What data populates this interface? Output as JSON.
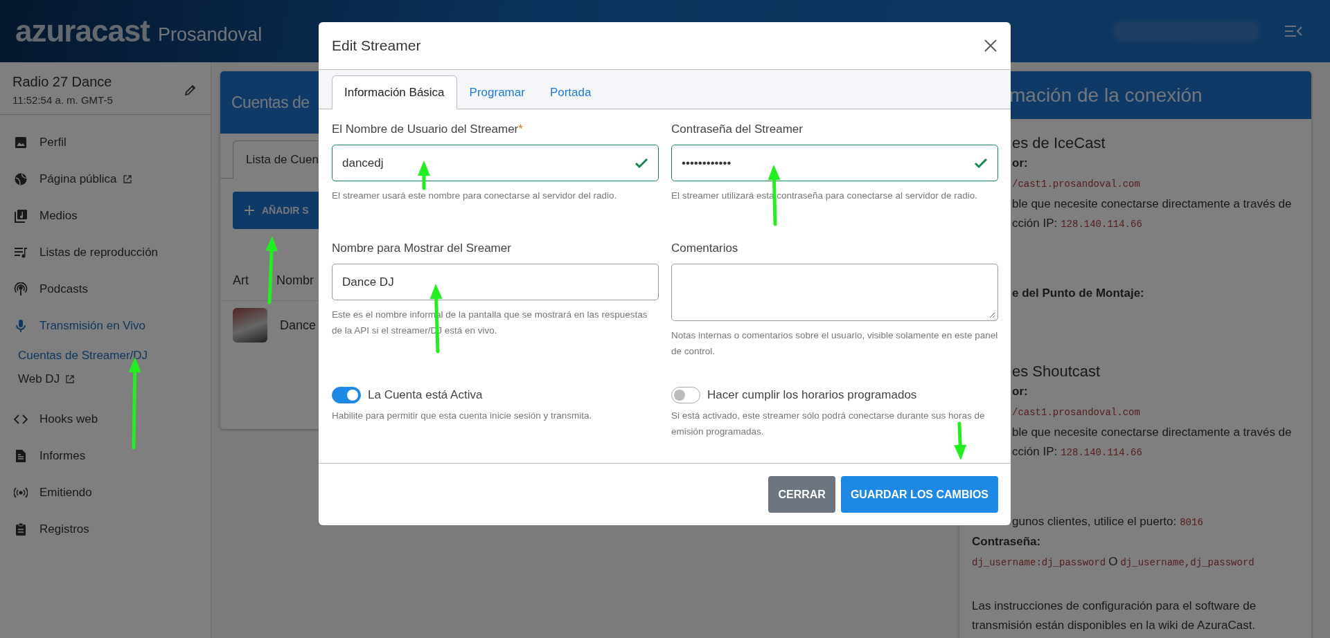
{
  "header": {
    "logo": "azura**cast**",
    "organization": "Prosandoval"
  },
  "sidebar": {
    "station": "Radio 27 Dance",
    "time": "11:52:54 a. m. GMT-5",
    "items": [
      {
        "label": "Perfil",
        "selected": false,
        "external": false
      },
      {
        "label": "Página pública",
        "selected": false,
        "external": true
      },
      {
        "label": "Medios",
        "selected": false,
        "external": false
      },
      {
        "label": "Listas de reproducción",
        "selected": false,
        "external": false
      },
      {
        "label": "Podcasts",
        "selected": false,
        "external": false
      },
      {
        "label": "Transmisión en Vivo",
        "selected": true,
        "external": false,
        "children": [
          {
            "label": "Cuentas de Streamer/DJ",
            "selected": true,
            "external": false
          },
          {
            "label": "Web DJ",
            "selected": false,
            "external": true
          }
        ]
      },
      {
        "label": "Hooks web",
        "selected": false,
        "external": false
      },
      {
        "label": "Informes",
        "selected": false,
        "external": false
      },
      {
        "label": "Emitiendo",
        "selected": false,
        "external": false
      },
      {
        "label": "Registros",
        "selected": false,
        "external": false
      }
    ]
  },
  "accounts_card": {
    "title": "Cuentas de",
    "tabs": [
      {
        "label": "Lista de Cuen",
        "selected": true
      }
    ],
    "add_button": "AÑADIR S",
    "columns": [
      "Art",
      "Nombr"
    ],
    "rows": [
      {
        "name": "Dance"
      }
    ]
  },
  "connection_card": {
    "title": "mación de la conexión",
    "sections": [
      {
        "lines": [
          {
            "kind": "heading",
            "text": "es de IceCast",
            "clipped": true
          },
          {
            "kind": "label",
            "text": "or:",
            "clipped": true
          },
          {
            "kind": "code",
            "text": "/cast1.prosandoval.com",
            "clipped": true
          },
          {
            "kind": "text",
            "text": "ble que necesite conectarse directamente a través de",
            "clipped": true
          },
          {
            "kind": "text",
            "text": "cción IP:",
            "code": "128.140.114.66",
            "clipped": true
          }
        ]
      },
      {
        "lines": [
          {
            "kind": "label",
            "text": "e del Punto de Montaje:",
            "clipped": true
          }
        ]
      },
      {
        "lines": [
          {
            "kind": "heading",
            "text": "es Shoutcast",
            "clipped": true
          },
          {
            "kind": "label",
            "text": "or:",
            "clipped": true
          },
          {
            "kind": "code",
            "text": "/cast1.prosandoval.com",
            "clipped": true
          },
          {
            "kind": "text",
            "text": "ble que necesite conectarse directamente a través de",
            "clipped": true
          },
          {
            "kind": "text",
            "text": "cción IP:",
            "code": "128.140.114.66",
            "clipped": true
          }
        ]
      },
      {
        "lines": [
          {
            "kind": "text",
            "text": "gunos clientes, utilice el puerto:",
            "code": "8016",
            "clipped": true
          },
          {
            "kind": "label",
            "text": "Contraseña:",
            "clipped": false
          },
          {
            "kind": "code",
            "text": "dj_username:dj_password",
            "after": "O",
            "code2": "dj_username,dj_password",
            "clipped": false
          }
        ]
      },
      {
        "lines": [
          {
            "kind": "text",
            "text": "Las instrucciones de configuración para el software de",
            "clipped": false
          },
          {
            "kind": "text",
            "text": "transmisión están disponibles en la wiki de AzuraCast.",
            "clipped": false
          }
        ]
      }
    ]
  },
  "modal": {
    "title": "Edit Streamer",
    "tabs": [
      {
        "label": "Información Básica",
        "selected": true
      },
      {
        "label": "Programar",
        "selected": false
      },
      {
        "label": "Portada",
        "selected": false
      }
    ],
    "fields": [
      {
        "kind": "input",
        "label": "El Nombre de Usuario del Streamer",
        "required_mark": "*",
        "value": "dancedj",
        "valid": true,
        "help": "El streamer usará este nombre para conectarse al servidor del radio."
      },
      {
        "kind": "input",
        "label": "Contraseña del Streamer",
        "value": "••••••••••••",
        "valid": true,
        "help": "El streamer utilizará esta contraseña para conectarse al servidor de radio."
      },
      {
        "kind": "input",
        "label": "Nombre para Mostrar del Sreamer",
        "value": "Dance DJ",
        "valid": false,
        "help": "Este es el nombre informal de la pantalla que se mostrará en las respuestas de la API si el streamer/DJ está en vivo."
      },
      {
        "kind": "textarea",
        "label": "Comentarios",
        "help": "Notas internas o comentarios sobre el usuario, visible solamente en este panel de control."
      },
      {
        "kind": "toggle",
        "label": "La Cuenta está Activa",
        "on": true,
        "help": "Habilite para permitir que esta cuenta inicie sesión y transmita."
      },
      {
        "kind": "toggle",
        "label": "Hacer cumplir los horarios programados",
        "on": false,
        "help": "Si está activado, este streamer sólo podrá conectarse durante sus horas de emisión programadas."
      }
    ],
    "buttons": [
      {
        "label": "CERRAR",
        "kind": "secondary"
      },
      {
        "label": "GUARDAR LOS CAMBIOS",
        "kind": "primary"
      }
    ]
  }
}
